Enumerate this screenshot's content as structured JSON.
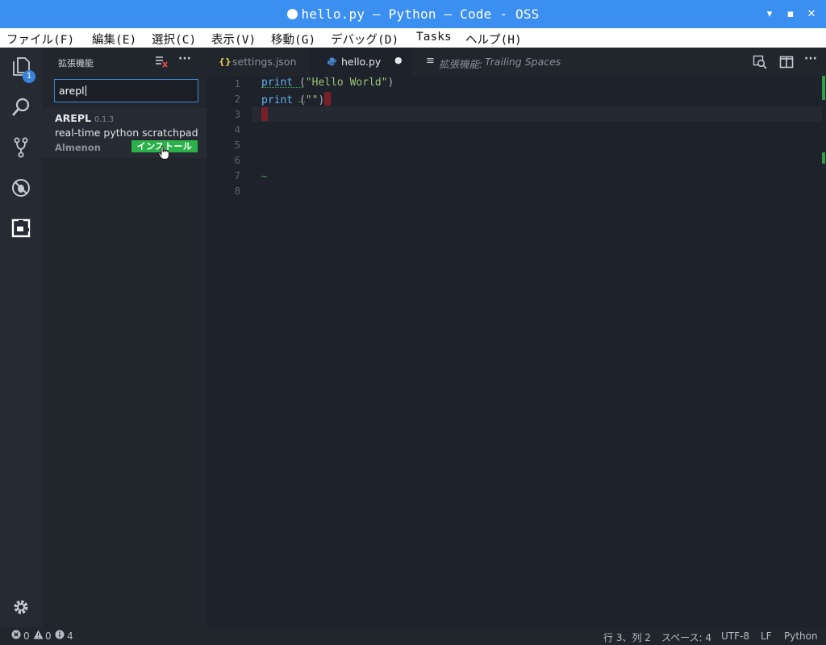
{
  "window": {
    "title": "hello.py — Python — Code - OSS",
    "minimize_glyph": "▾",
    "maximize_glyph": "▪",
    "close_glyph": "✕"
  },
  "menu": [
    "ファイル(F)",
    "編集(E)",
    "選択(C)",
    "表示(V)",
    "移動(G)",
    "デバッグ(D)",
    "Tasks",
    "ヘルプ(H)"
  ],
  "activity": {
    "explorer_badge": "1",
    "items": [
      "explorer-icon",
      "search-icon",
      "source-control-icon",
      "debug-icon",
      "extensions-icon",
      "gear-icon"
    ]
  },
  "sidebar": {
    "title": "拡張機能",
    "more_glyph": "···",
    "search_value": "arepl",
    "extension": {
      "name": "AREPL",
      "version": "0.1.3",
      "description": "real-time python scratchpad",
      "publisher": "Almenon",
      "install_label": "インストール"
    }
  },
  "tabs": [
    {
      "icon": "{}",
      "label": "settings.json",
      "active": false
    },
    {
      "icon": "python-icon",
      "label": "hello.py",
      "active": true,
      "dirty_glyph": "●"
    },
    {
      "icon": "≡",
      "label_prefix": "拡張機能:",
      "label": "Trailing Spaces",
      "active": false
    }
  ],
  "editor": {
    "line_numbers": [
      "1",
      "2",
      "3",
      "4",
      "5",
      "6",
      "7",
      "8"
    ],
    "lines": [
      {
        "kw": "print",
        "rest": " (",
        "str": "\"Hello World\"",
        "end": ")"
      },
      {
        "kw": "print",
        "rest": " (",
        "str": "\"\"",
        "end": ")"
      }
    ],
    "tilde": "~"
  },
  "status": {
    "errors": "0",
    "warnings": "0",
    "info": "4",
    "position": "行 3、列 2",
    "spaces": "スペース: 4",
    "encoding": "UTF-8",
    "eol": "LF",
    "language": "Python"
  },
  "colors": {
    "titlebar": "#3a8ff0",
    "install": "#2cb14a",
    "accent": "#3d89d8"
  }
}
